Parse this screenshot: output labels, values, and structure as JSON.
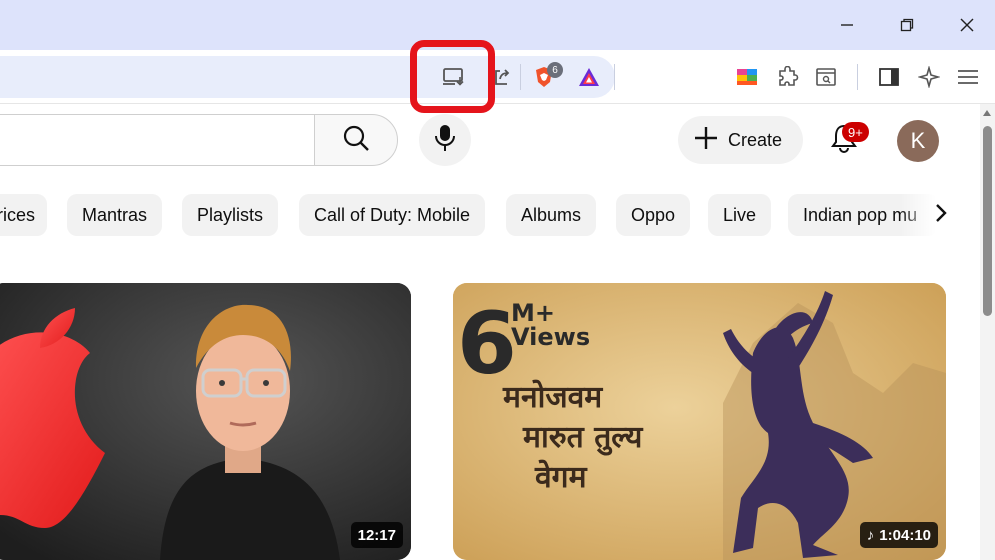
{
  "window": {
    "controls": {
      "minimize": "minimize-icon",
      "restore": "restore-icon",
      "close": "close-icon"
    }
  },
  "toolbar": {
    "extensions": [
      {
        "name": "cast-install-icon",
        "highlighted": true
      },
      {
        "name": "share-icon"
      },
      {
        "name": "brave-shield-icon",
        "badge": "6"
      },
      {
        "name": "brave-rewards-icon"
      }
    ],
    "right_icons": [
      "tab-colors-icon",
      "extensions-icon",
      "reader-icon",
      "sidebar-icon",
      "leo-ai-icon",
      "menu-icon"
    ],
    "highlight_color": "#e5141b"
  },
  "youtube": {
    "create_label": "Create",
    "notifications_badge": "9+",
    "avatar_letter": "K",
    "chips": [
      {
        "label": "rices"
      },
      {
        "label": "Mantras"
      },
      {
        "label": "Playlists"
      },
      {
        "label": "Call of Duty: Mobile"
      },
      {
        "label": "Albums"
      },
      {
        "label": "Oppo"
      },
      {
        "label": "Live"
      },
      {
        "label": "Indian pop mu"
      }
    ],
    "videos": [
      {
        "duration": "12:17"
      },
      {
        "duration": "1:04:10",
        "overlay_big": "6",
        "overlay_views_1": "M+",
        "overlay_views_2": "Views",
        "hindi_lines": [
          "मनोजवम",
          "मारुत तुल्य",
          "वेगम"
        ]
      }
    ]
  },
  "colors": {
    "titlebar": "#dde3fb",
    "notif_red": "#cc0000",
    "thumb2_bg": "#d9b36a"
  }
}
